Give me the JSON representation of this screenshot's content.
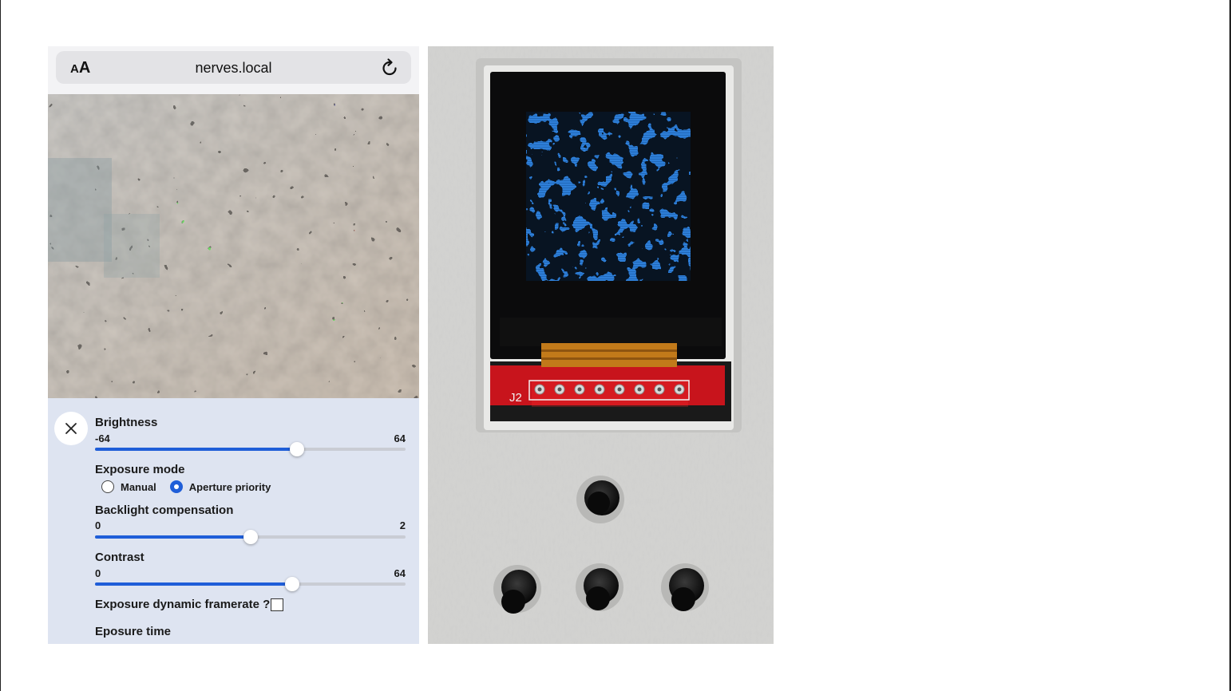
{
  "browser": {
    "text_size_label": "AA",
    "url": "nerves.local"
  },
  "camera_controls": {
    "brightness": {
      "label": "Brightness",
      "min": "-64",
      "max": "64",
      "value_fraction": 0.65
    },
    "exposure_mode": {
      "label": "Exposure mode",
      "options": [
        "Manual",
        "Aperture priority"
      ],
      "selected": "Aperture priority"
    },
    "backlight_compensation": {
      "label": "Backlight compensation",
      "min": "0",
      "max": "2",
      "value_fraction": 0.5
    },
    "contrast": {
      "label": "Contrast",
      "min": "0",
      "max": "64",
      "value_fraction": 0.635
    },
    "exposure_dynamic_framerate": {
      "label": "Exposure dynamic framerate ?",
      "checked": false
    },
    "exposure_time": {
      "label": "Eposure time"
    }
  },
  "device_photo": {
    "header_label": "J2",
    "pin_count": 8
  },
  "colors": {
    "accent": "#1f5ed8",
    "panel_bg": "#dee4f1",
    "screen_blue": "#2f7fd8",
    "pcb_red": "#c8141c"
  }
}
